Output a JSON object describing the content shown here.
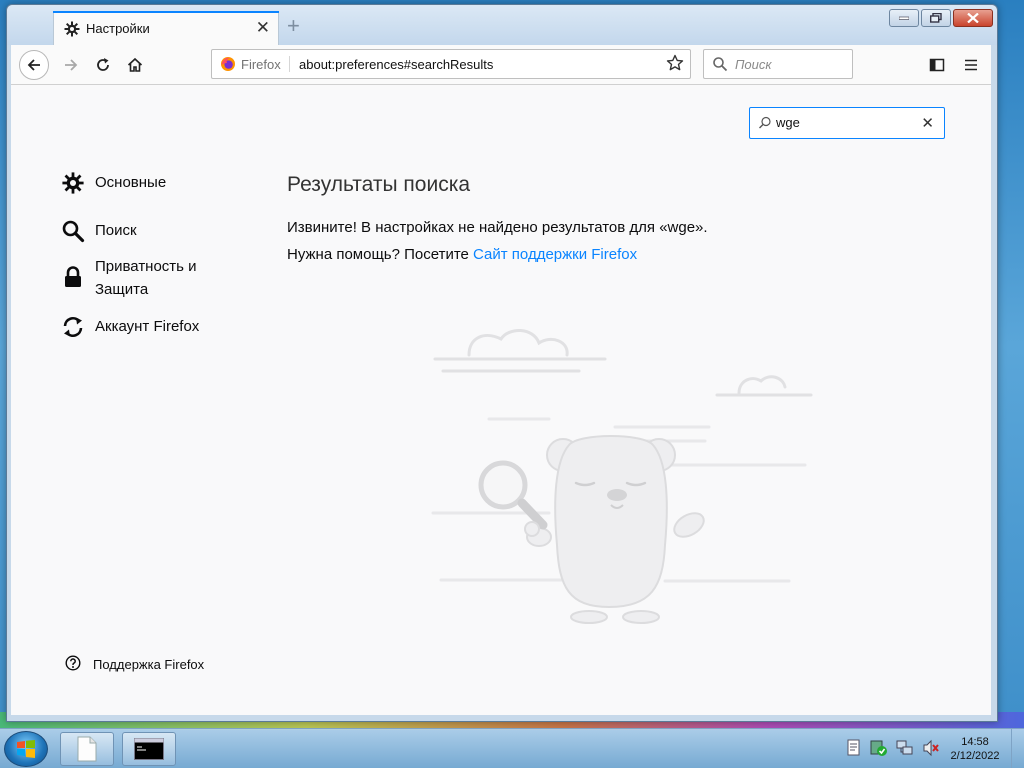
{
  "browser": {
    "tab": {
      "title": "Настройки"
    },
    "url_identity": "Firefox",
    "url": "about:preferences#searchResults",
    "search_placeholder": "Поиск"
  },
  "preferences": {
    "search_value": "wge",
    "sidebar": [
      {
        "label": "Основные",
        "icon": "gear-icon"
      },
      {
        "label": "Поиск",
        "icon": "search-icon"
      },
      {
        "label": "Приватность и Защита",
        "icon": "lock-icon"
      },
      {
        "label": "Аккаунт Firefox",
        "icon": "sync-icon"
      }
    ],
    "support_label": "Поддержка Firefox",
    "results_title": "Результаты поиска",
    "no_results_text": "Извините! В настройках не найдено результатов для «wge».",
    "help_prefix": "Нужна помощь? Посетите ",
    "help_link": "Сайт поддержки Firefox"
  },
  "taskbar": {
    "time": "14:58",
    "date": "2/12/2022"
  },
  "colors": {
    "accent": "#0a84ff",
    "content_bg": "#f9f9fa"
  }
}
